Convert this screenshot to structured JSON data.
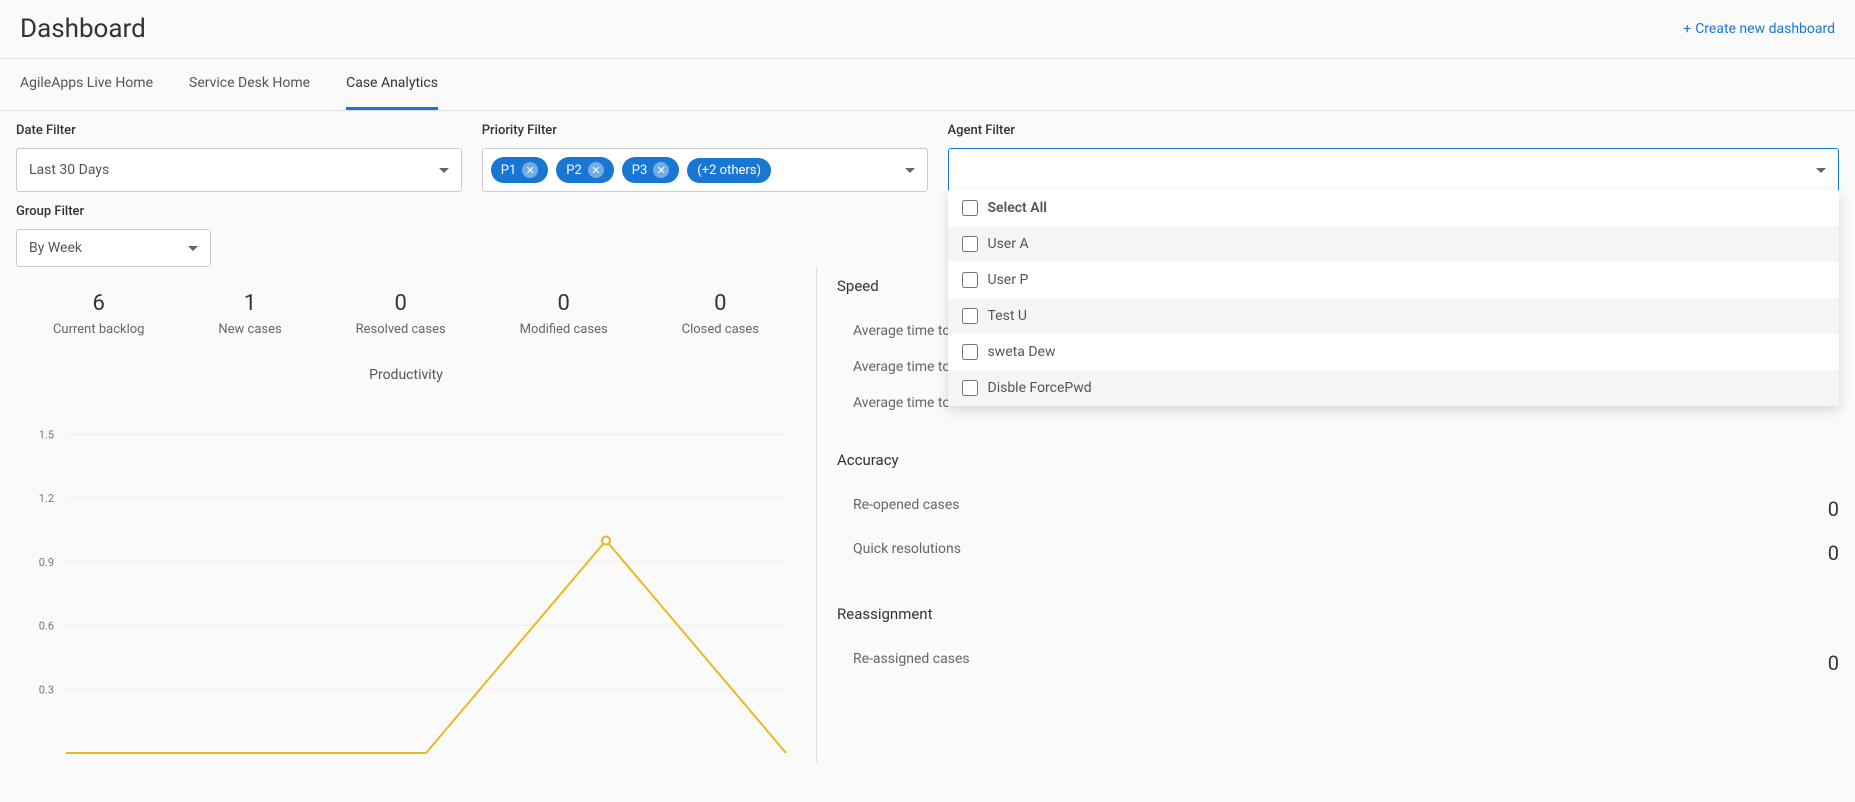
{
  "header": {
    "title": "Dashboard",
    "create_link": "Create new dashboard"
  },
  "tabs": [
    "AgileApps Live Home",
    "Service Desk Home",
    "Case Analytics"
  ],
  "active_tab": 2,
  "filters": {
    "date": {
      "label": "Date Filter",
      "value": "Last 30 Days"
    },
    "priority": {
      "label": "Priority Filter",
      "chips": [
        "P1",
        "P2",
        "P3"
      ],
      "extra": "(+2 others)"
    },
    "agent": {
      "label": "Agent Filter",
      "options": [
        "Select All",
        "User A",
        "User P",
        "Test U",
        "sweta Dew",
        "Disble ForcePwd"
      ]
    },
    "group": {
      "label": "Group Filter",
      "value": "By Week"
    }
  },
  "stats": [
    {
      "value": "6",
      "label": "Current backlog"
    },
    {
      "value": "1",
      "label": "New cases"
    },
    {
      "value": "0",
      "label": "Resolved cases"
    },
    {
      "value": "0",
      "label": "Modified cases"
    },
    {
      "value": "0",
      "label": "Closed cases"
    }
  ],
  "chart": {
    "title": "Productivity"
  },
  "chart_data": {
    "type": "line",
    "title": "Productivity",
    "ylabel": "",
    "xlabel": "",
    "ylim": [
      0,
      1.6
    ],
    "y_ticks": [
      0.3,
      0.6,
      0.9,
      1.2,
      1.5
    ],
    "x": [
      0,
      1,
      2,
      3,
      4
    ],
    "series": [
      {
        "name": "Productivity",
        "values": [
          0,
          0,
          0,
          1,
          0
        ]
      }
    ]
  },
  "speed": {
    "title": "Speed",
    "rows": [
      {
        "label": "Average time to",
        "value": ""
      },
      {
        "label": "Average time to",
        "value": ""
      },
      {
        "label": "Average time to",
        "value": ""
      }
    ]
  },
  "accuracy": {
    "title": "Accuracy",
    "rows": [
      {
        "label": "Re-opened cases",
        "value": "0"
      },
      {
        "label": "Quick resolutions",
        "value": "0"
      }
    ]
  },
  "reassignment": {
    "title": "Reassignment",
    "rows": [
      {
        "label": "Re-assigned cases",
        "value": "0"
      }
    ]
  }
}
